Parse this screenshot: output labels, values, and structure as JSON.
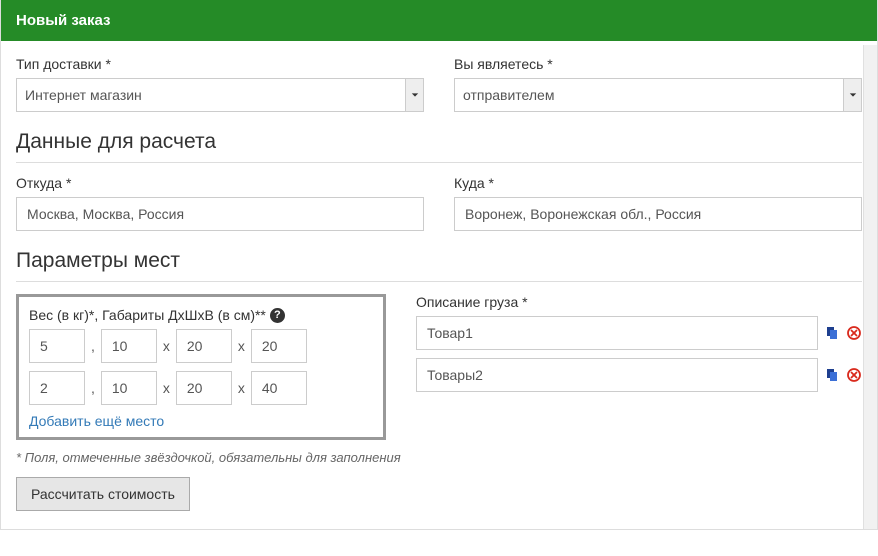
{
  "header": {
    "title": "Новый заказ"
  },
  "delivery": {
    "type_label": "Тип доставки *",
    "type_value": "Интернет магазин",
    "role_label": "Вы являетесь *",
    "role_value": "отправителем"
  },
  "calc_section_title": "Данные для расчета",
  "from": {
    "label": "Откуда *",
    "value": "Москва, Москва, Россия"
  },
  "to": {
    "label": "Куда *",
    "value": "Воронеж, Воронежская обл., Россия"
  },
  "params_section_title": "Параметры мест",
  "dims_label": "Вес (в кг)*, Габариты ДхШхВ (в см)**",
  "help_icon": "?",
  "places": [
    {
      "weight": "5",
      "l": "10",
      "w": "20",
      "h": "20"
    },
    {
      "weight": "2",
      "l": "10",
      "w": "20",
      "h": "40"
    }
  ],
  "sep_comma": ",",
  "sep_x": "x",
  "add_place": "Добавить ещё место",
  "cargo_label": "Описание груза *",
  "cargo": [
    "Товар1",
    "Товары2"
  ],
  "note": "* Поля, отмеченные звёздочкой, обязательны для заполнения",
  "calc_btn": "Рассчитать стоимость"
}
